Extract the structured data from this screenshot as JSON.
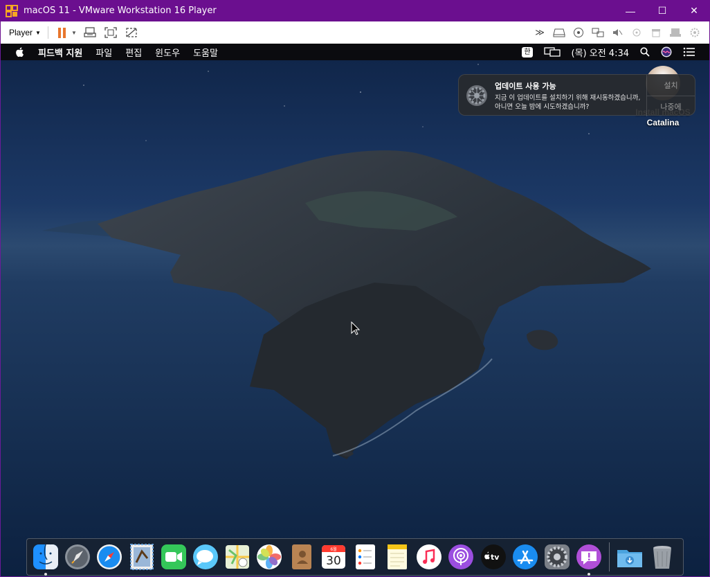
{
  "window": {
    "title": "macOS 11 - VMware Workstation 16 Player",
    "minimize_glyph": "—",
    "maximize_glyph": "☐",
    "close_glyph": "✕"
  },
  "toolbar": {
    "player_label": "Player",
    "icons": [
      "pause-icon",
      "send-ctrl-alt-del-icon",
      "fullscreen-icon",
      "unity-icon"
    ],
    "right_icons": [
      "more-icon",
      "hard-disk-icon",
      "cd-icon",
      "network-icon",
      "sound-icon",
      "usb-icon",
      "printer-icon",
      "camera-icon",
      "settings-icon"
    ]
  },
  "menubar": {
    "app_name": "피드백 지원",
    "items": [
      "파일",
      "편집",
      "윈도우",
      "도움말"
    ],
    "input_source": "한",
    "clock": "(목) 오전 4:34"
  },
  "notification": {
    "title": "업데이트 사용 가능",
    "message": "지금 이 업데이트를 설치하기 위해 재시동하겠습니까, 아니면 오늘 밤에 시도하겠습니까?",
    "install_label": "설치",
    "later_label": "나중에"
  },
  "desktop_icon": {
    "label": "Install macOS Catalina"
  },
  "dock": {
    "calendar_month": "6월",
    "calendar_day": "30",
    "apps": [
      "Finder",
      "Launchpad",
      "Safari",
      "Mail",
      "FaceTime",
      "Messages",
      "Maps",
      "Photos",
      "Contacts",
      "Calendar",
      "Reminders",
      "Notes",
      "Music",
      "Podcasts",
      "TV",
      "App Store",
      "System Preferences",
      "Feedback Assistant",
      "Downloads",
      "Trash"
    ],
    "tv_label": "tv"
  }
}
